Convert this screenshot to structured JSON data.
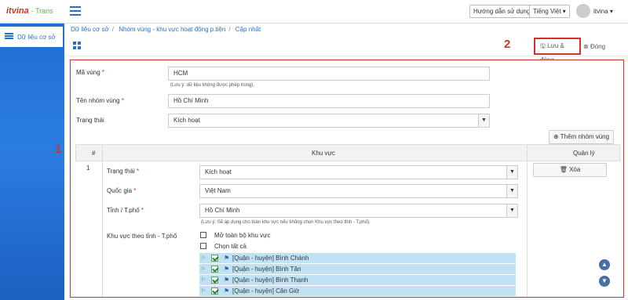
{
  "app": {
    "logo_text": "itvina",
    "logo_tag": "- Trans"
  },
  "header": {
    "help_label": "Hướng dẫn sử dụng",
    "language_label": "Tiếng Việt",
    "user_name": "itvina"
  },
  "sidebar": {
    "items": [
      {
        "label": "Dữ liệu cơ sở"
      }
    ]
  },
  "breadcrumb": [
    "Dữ liệu cơ sở",
    "Nhóm vùng - khu vực hoạt động p.tiện",
    "Cập nhật"
  ],
  "toolbar": {
    "save_label": "Lưu & đóng",
    "close_label": "Đóng",
    "annotation_2": "2"
  },
  "form": {
    "annotation_1": "1",
    "code": {
      "label": "Mã vùng",
      "value": "HCM",
      "hint": "(Lưu ý: dữ liệu không được phép trùng)."
    },
    "group_name": {
      "label": "Tên nhóm vùng",
      "value": "Hồ Chí Minh"
    },
    "status": {
      "label": "Trạng thái",
      "value": "Kích hoạt"
    },
    "add_button": "Thêm nhóm vùng",
    "table": {
      "headers": {
        "index": "#",
        "area": "Khu vực",
        "manage": "Quản lý"
      },
      "row": {
        "index": "1",
        "status": {
          "label": "Trạng thái",
          "value": "Kích hoạt"
        },
        "country": {
          "label": "Quốc gia",
          "value": "Việt Nam"
        },
        "province": {
          "label": "Tỉnh / T.phố",
          "value": "Hồ Chí Minh",
          "hint": "(Lưu ý: Sẽ áp dụng cho toàn khu vực nếu không chọn Khu vực theo tỉnh - T.phố)."
        },
        "area_by_province_label": "Khu vực theo tỉnh - T.phố",
        "open_all": "Mở toàn bộ khu vực",
        "select_all": "Chọn tất cả",
        "districts": [
          "[Quận - huyện] Bình Chánh",
          "[Quận - huyện] Bình Tân",
          "[Quận - huyện] Bình Thạnh",
          "[Quận - huyện] Cần Giờ"
        ],
        "delete_label": "Xóa"
      }
    }
  },
  "colors": {
    "accent": "#2a6fc6",
    "annotation": "#d32f2f",
    "tree_highlight": "#bfe3f5"
  }
}
